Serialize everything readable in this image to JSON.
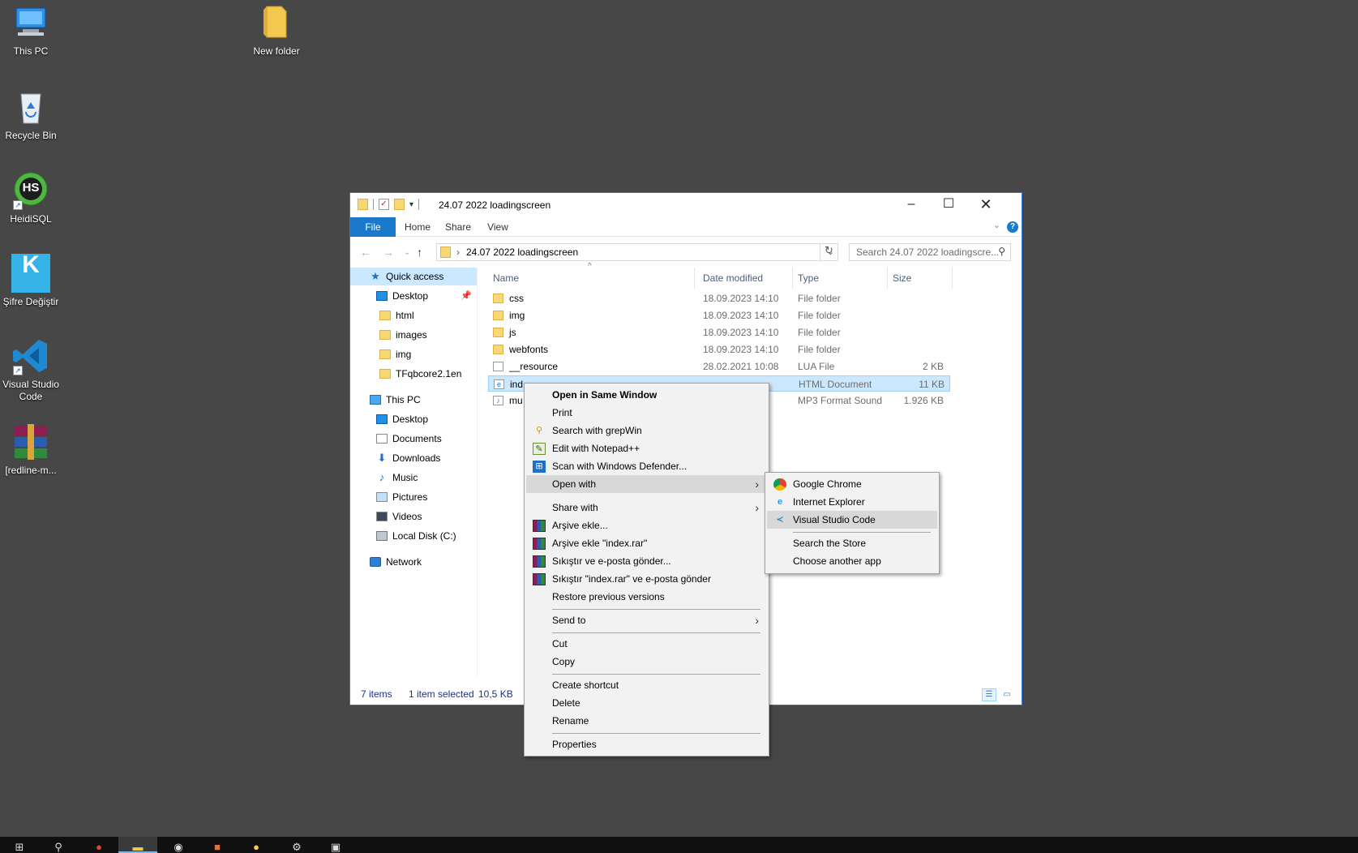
{
  "desktop_icons": [
    {
      "label": "This PC",
      "icon": "this-pc-icon"
    },
    {
      "label": "New folder",
      "icon": "folder-icon"
    },
    {
      "label": "Recycle Bin",
      "icon": "recycle-bin-icon"
    },
    {
      "label": "HeidiSQL",
      "icon": "heidisql-icon",
      "glyph": "HS"
    },
    {
      "label": "Şifre Değiştir",
      "icon": "sifre-degistir-icon",
      "glyph": "K"
    },
    {
      "label": "Visual Studio Code",
      "icon": "vscode-icon"
    },
    {
      "label": "[redline-m...",
      "icon": "winrar-icon"
    }
  ],
  "window": {
    "title": "24.07 2022 loadingscreen",
    "ribbon_tabs": [
      "File",
      "Home",
      "Share",
      "View"
    ],
    "address": "24.07 2022 loadingscreen",
    "search_placeholder": "Search 24.07 2022 loadingscre...",
    "nav": {
      "quick_access": "Quick access",
      "quick_items": [
        "Desktop",
        "html",
        "images",
        "img",
        "TFqbcore2.1en"
      ],
      "this_pc": "This PC",
      "pc_items": [
        "Desktop",
        "Documents",
        "Downloads",
        "Music",
        "Pictures",
        "Videos",
        "Local Disk (C:)"
      ],
      "network": "Network"
    },
    "columns": [
      "Name",
      "Date modified",
      "Type",
      "Size"
    ],
    "files": [
      {
        "name": "css",
        "date": "18.09.2023 14:10",
        "type": "File folder",
        "size": ""
      },
      {
        "name": "img",
        "date": "18.09.2023 14:10",
        "type": "File folder",
        "size": ""
      },
      {
        "name": "js",
        "date": "18.09.2023 14:10",
        "type": "File folder",
        "size": ""
      },
      {
        "name": "webfonts",
        "date": "18.09.2023 14:10",
        "type": "File folder",
        "size": ""
      },
      {
        "name": "__resource",
        "date": "28.02.2021 10:08",
        "type": "LUA File",
        "size": "2 KB"
      },
      {
        "name": "ind",
        "date": "",
        "type": "HTML Document",
        "size": "11 KB",
        "selected": true
      },
      {
        "name": "mu",
        "date": "",
        "type": "MP3 Format Sound",
        "size": "1.926 KB"
      }
    ],
    "status": {
      "items": "7 items",
      "selected": "1 item selected",
      "size": "10,5 KB"
    }
  },
  "context_menu": {
    "items": [
      {
        "label": "Open in Same Window",
        "bold": true
      },
      {
        "label": "Print"
      },
      {
        "label": "Search with grepWin",
        "icon": "grepwin-icon"
      },
      {
        "label": "Edit with Notepad++",
        "icon": "notepad-plus-plus-icon"
      },
      {
        "label": "Scan with Windows Defender...",
        "icon": "windows-defender-icon"
      },
      {
        "label": "Open with",
        "submenu": true,
        "highlighted": true
      },
      {
        "label": "Share with",
        "submenu": true
      },
      {
        "label": "Arşive ekle...",
        "icon": "winrar-icon"
      },
      {
        "label": "Arşive ekle \"index.rar\"",
        "icon": "winrar-icon"
      },
      {
        "label": "Sıkıştır ve e-posta gönder...",
        "icon": "winrar-icon"
      },
      {
        "label": "Sıkıştır \"index.rar\" ve e-posta gönder",
        "icon": "winrar-icon"
      },
      {
        "label": "Restore previous versions"
      },
      {
        "label": "Send to",
        "submenu": true
      },
      {
        "label": "Cut"
      },
      {
        "label": "Copy"
      },
      {
        "label": "Create shortcut"
      },
      {
        "label": "Delete"
      },
      {
        "label": "Rename"
      },
      {
        "label": "Properties"
      }
    ]
  },
  "open_with_menu": {
    "items": [
      {
        "label": "Google Chrome",
        "icon": "chrome-icon"
      },
      {
        "label": "Internet Explorer",
        "icon": "internet-explorer-icon"
      },
      {
        "label": "Visual Studio Code",
        "icon": "vscode-icon",
        "highlighted": true
      },
      {
        "label": "Search the Store"
      },
      {
        "label": "Choose another app"
      }
    ]
  },
  "taskbar": [
    "start-icon",
    "search-icon",
    "chrome-icon",
    "file-explorer-icon",
    "obs-icon",
    "app-icon",
    "lightbulb-icon",
    "settings-icon",
    "terminal-icon"
  ]
}
